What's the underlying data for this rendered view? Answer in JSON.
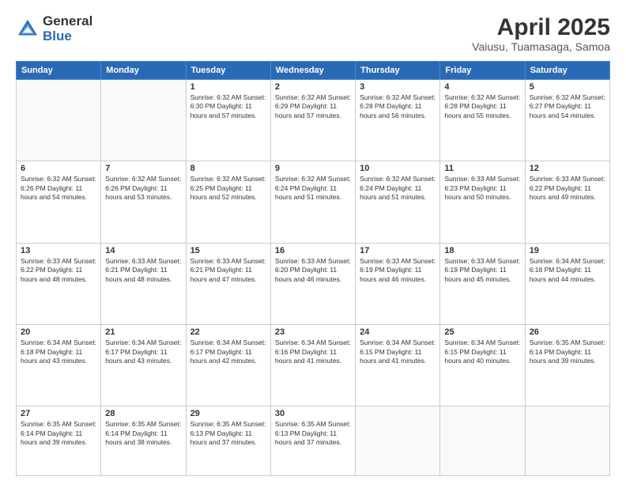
{
  "header": {
    "logo_general": "General",
    "logo_blue": "Blue",
    "title": "April 2025",
    "location": "Vaiusu, Tuamasaga, Samoa"
  },
  "weekdays": [
    "Sunday",
    "Monday",
    "Tuesday",
    "Wednesday",
    "Thursday",
    "Friday",
    "Saturday"
  ],
  "weeks": [
    [
      {
        "day": "",
        "info": ""
      },
      {
        "day": "",
        "info": ""
      },
      {
        "day": "1",
        "info": "Sunrise: 6:32 AM\nSunset: 6:30 PM\nDaylight: 11 hours\nand 57 minutes."
      },
      {
        "day": "2",
        "info": "Sunrise: 6:32 AM\nSunset: 6:29 PM\nDaylight: 11 hours\nand 57 minutes."
      },
      {
        "day": "3",
        "info": "Sunrise: 6:32 AM\nSunset: 6:28 PM\nDaylight: 11 hours\nand 56 minutes."
      },
      {
        "day": "4",
        "info": "Sunrise: 6:32 AM\nSunset: 6:28 PM\nDaylight: 11 hours\nand 55 minutes."
      },
      {
        "day": "5",
        "info": "Sunrise: 6:32 AM\nSunset: 6:27 PM\nDaylight: 11 hours\nand 54 minutes."
      }
    ],
    [
      {
        "day": "6",
        "info": "Sunrise: 6:32 AM\nSunset: 6:26 PM\nDaylight: 11 hours\nand 54 minutes."
      },
      {
        "day": "7",
        "info": "Sunrise: 6:32 AM\nSunset: 6:26 PM\nDaylight: 11 hours\nand 53 minutes."
      },
      {
        "day": "8",
        "info": "Sunrise: 6:32 AM\nSunset: 6:25 PM\nDaylight: 11 hours\nand 52 minutes."
      },
      {
        "day": "9",
        "info": "Sunrise: 6:32 AM\nSunset: 6:24 PM\nDaylight: 11 hours\nand 51 minutes."
      },
      {
        "day": "10",
        "info": "Sunrise: 6:32 AM\nSunset: 6:24 PM\nDaylight: 11 hours\nand 51 minutes."
      },
      {
        "day": "11",
        "info": "Sunrise: 6:33 AM\nSunset: 6:23 PM\nDaylight: 11 hours\nand 50 minutes."
      },
      {
        "day": "12",
        "info": "Sunrise: 6:33 AM\nSunset: 6:22 PM\nDaylight: 11 hours\nand 49 minutes."
      }
    ],
    [
      {
        "day": "13",
        "info": "Sunrise: 6:33 AM\nSunset: 6:22 PM\nDaylight: 11 hours\nand 48 minutes."
      },
      {
        "day": "14",
        "info": "Sunrise: 6:33 AM\nSunset: 6:21 PM\nDaylight: 11 hours\nand 48 minutes."
      },
      {
        "day": "15",
        "info": "Sunrise: 6:33 AM\nSunset: 6:21 PM\nDaylight: 11 hours\nand 47 minutes."
      },
      {
        "day": "16",
        "info": "Sunrise: 6:33 AM\nSunset: 6:20 PM\nDaylight: 11 hours\nand 46 minutes."
      },
      {
        "day": "17",
        "info": "Sunrise: 6:33 AM\nSunset: 6:19 PM\nDaylight: 11 hours\nand 46 minutes."
      },
      {
        "day": "18",
        "info": "Sunrise: 6:33 AM\nSunset: 6:19 PM\nDaylight: 11 hours\nand 45 minutes."
      },
      {
        "day": "19",
        "info": "Sunrise: 6:34 AM\nSunset: 6:18 PM\nDaylight: 11 hours\nand 44 minutes."
      }
    ],
    [
      {
        "day": "20",
        "info": "Sunrise: 6:34 AM\nSunset: 6:18 PM\nDaylight: 11 hours\nand 43 minutes."
      },
      {
        "day": "21",
        "info": "Sunrise: 6:34 AM\nSunset: 6:17 PM\nDaylight: 11 hours\nand 43 minutes."
      },
      {
        "day": "22",
        "info": "Sunrise: 6:34 AM\nSunset: 6:17 PM\nDaylight: 11 hours\nand 42 minutes."
      },
      {
        "day": "23",
        "info": "Sunrise: 6:34 AM\nSunset: 6:16 PM\nDaylight: 11 hours\nand 41 minutes."
      },
      {
        "day": "24",
        "info": "Sunrise: 6:34 AM\nSunset: 6:15 PM\nDaylight: 11 hours\nand 41 minutes."
      },
      {
        "day": "25",
        "info": "Sunrise: 6:34 AM\nSunset: 6:15 PM\nDaylight: 11 hours\nand 40 minutes."
      },
      {
        "day": "26",
        "info": "Sunrise: 6:35 AM\nSunset: 6:14 PM\nDaylight: 11 hours\nand 39 minutes."
      }
    ],
    [
      {
        "day": "27",
        "info": "Sunrise: 6:35 AM\nSunset: 6:14 PM\nDaylight: 11 hours\nand 39 minutes."
      },
      {
        "day": "28",
        "info": "Sunrise: 6:35 AM\nSunset: 6:14 PM\nDaylight: 11 hours\nand 38 minutes."
      },
      {
        "day": "29",
        "info": "Sunrise: 6:35 AM\nSunset: 6:13 PM\nDaylight: 11 hours\nand 37 minutes."
      },
      {
        "day": "30",
        "info": "Sunrise: 6:35 AM\nSunset: 6:13 PM\nDaylight: 11 hours\nand 37 minutes."
      },
      {
        "day": "",
        "info": ""
      },
      {
        "day": "",
        "info": ""
      },
      {
        "day": "",
        "info": ""
      }
    ]
  ]
}
